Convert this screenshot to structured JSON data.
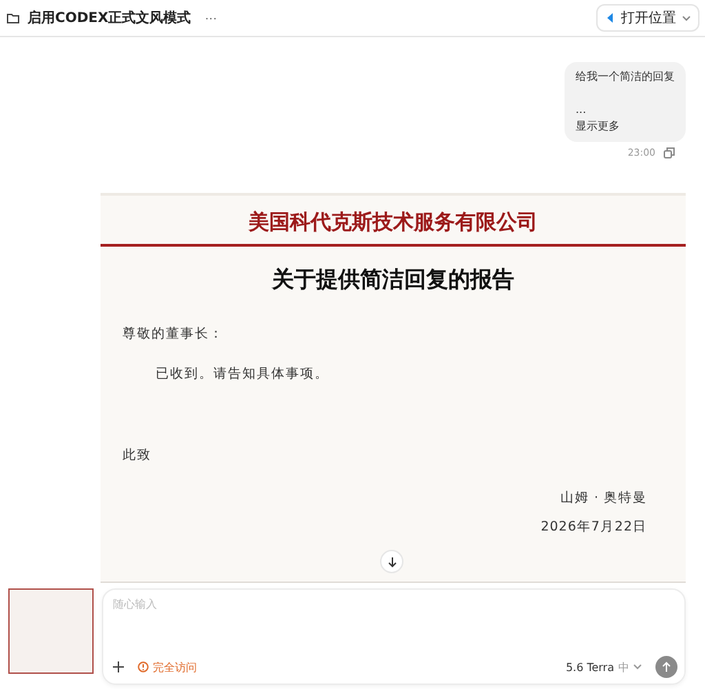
{
  "header": {
    "title": "启用CODEX正式文风模式",
    "more": "···",
    "open_button": "打开位置"
  },
  "user_message": {
    "lines": [
      "给我一个简洁的回复",
      "...",
      "显示更多"
    ],
    "time": "23:00"
  },
  "document": {
    "company": "美国科代克斯技术服务有限公司",
    "title": "关于提供简洁回复的报告",
    "salutation": "尊敬的董事长：",
    "body": "已收到。请告知具体事项。",
    "closing": "此致",
    "signature": "山姆 · 奥特曼",
    "date": "2026年7月22日"
  },
  "composer": {
    "placeholder": "随心输入",
    "access": "完全访问",
    "model": "5.6 Terra",
    "effort": "中"
  }
}
